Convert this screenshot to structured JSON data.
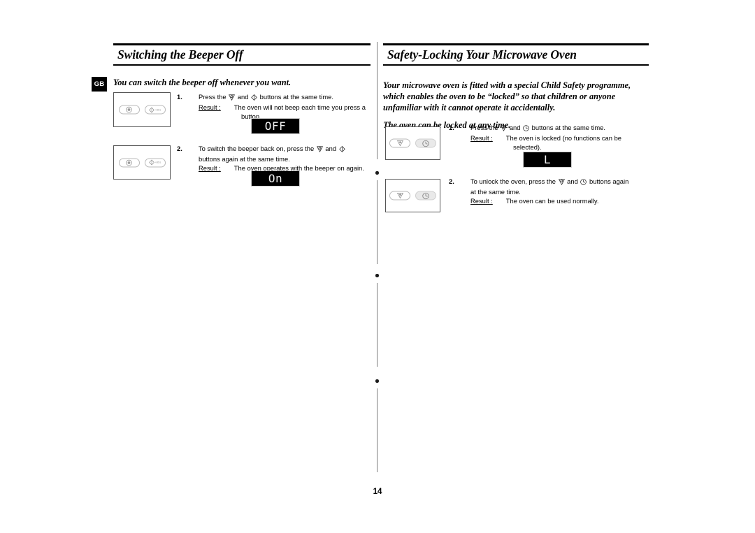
{
  "page": {
    "number": "14",
    "locale_badge": "GB"
  },
  "left_column": {
    "heading": "Switching the Beeper Off",
    "intro": "You can switch the beeper off whenever you want.",
    "panel": {
      "buttons": [
        {
          "icon": "stop-clear-icon",
          "label": ""
        },
        {
          "icon": "power-plus-30s-icon",
          "label": "+30 s"
        }
      ]
    },
    "steps": [
      {
        "number": "1.",
        "lines": [
          "Press the   and   buttons at the same time."
        ],
        "icon_tokens": [
          "stop-clear-icon",
          "power-icon"
        ],
        "result_label": "Result :",
        "result_lines": [
          "The oven will not beep each time you press a",
          "button."
        ],
        "display": "OFF"
      },
      {
        "number": "2.",
        "lines": [
          "To switch the beeper back on, press the   and  ",
          "buttons again at the same time."
        ],
        "icon_tokens": [
          "stop-clear-icon",
          "power-icon"
        ],
        "result_label": "Result :",
        "result_lines": [
          "The oven operates with the beeper on again."
        ],
        "display": "On"
      }
    ]
  },
  "right_column": {
    "heading": "Safety-Locking Your Microwave Oven",
    "intro_1": "Your microwave oven is fitted with a special Child Safety programme, which enables the oven to be “locked” so that children or anyone unfamiliar with it cannot operate it accidentally.",
    "intro_2": "The oven can be locked at any time.",
    "panel": {
      "buttons": [
        {
          "icon": "stop-clear-icon",
          "label": ""
        },
        {
          "icon": "clock-icon",
          "label": ""
        }
      ]
    },
    "steps": [
      {
        "number": "1.",
        "lines": [
          "Press the   and   buttons at the same time."
        ],
        "icon_tokens": [
          "stop-clear-icon",
          "clock-icon"
        ],
        "result_label": "Result :",
        "result_lines": [
          "The oven is locked (no functions can be",
          "selected)."
        ],
        "display": "L"
      },
      {
        "number": "2.",
        "lines": [
          "To unlock the oven, press the   and   buttons again",
          "at the same time."
        ],
        "icon_tokens": [
          "stop-clear-icon",
          "clock-icon"
        ],
        "result_label": "Result :",
        "result_lines": [
          "The oven can be used normally."
        ],
        "display": ""
      }
    ]
  },
  "colors": {
    "ink": "#000000",
    "paper": "#ffffff",
    "rule": "#000000",
    "panel_border": "#555555",
    "pill_border": "#b9b9b9",
    "pill_shade": "#e9e9e9",
    "divider": "#7d7d7d",
    "led_background": "#000000",
    "led_text": "#f2f2f2"
  }
}
